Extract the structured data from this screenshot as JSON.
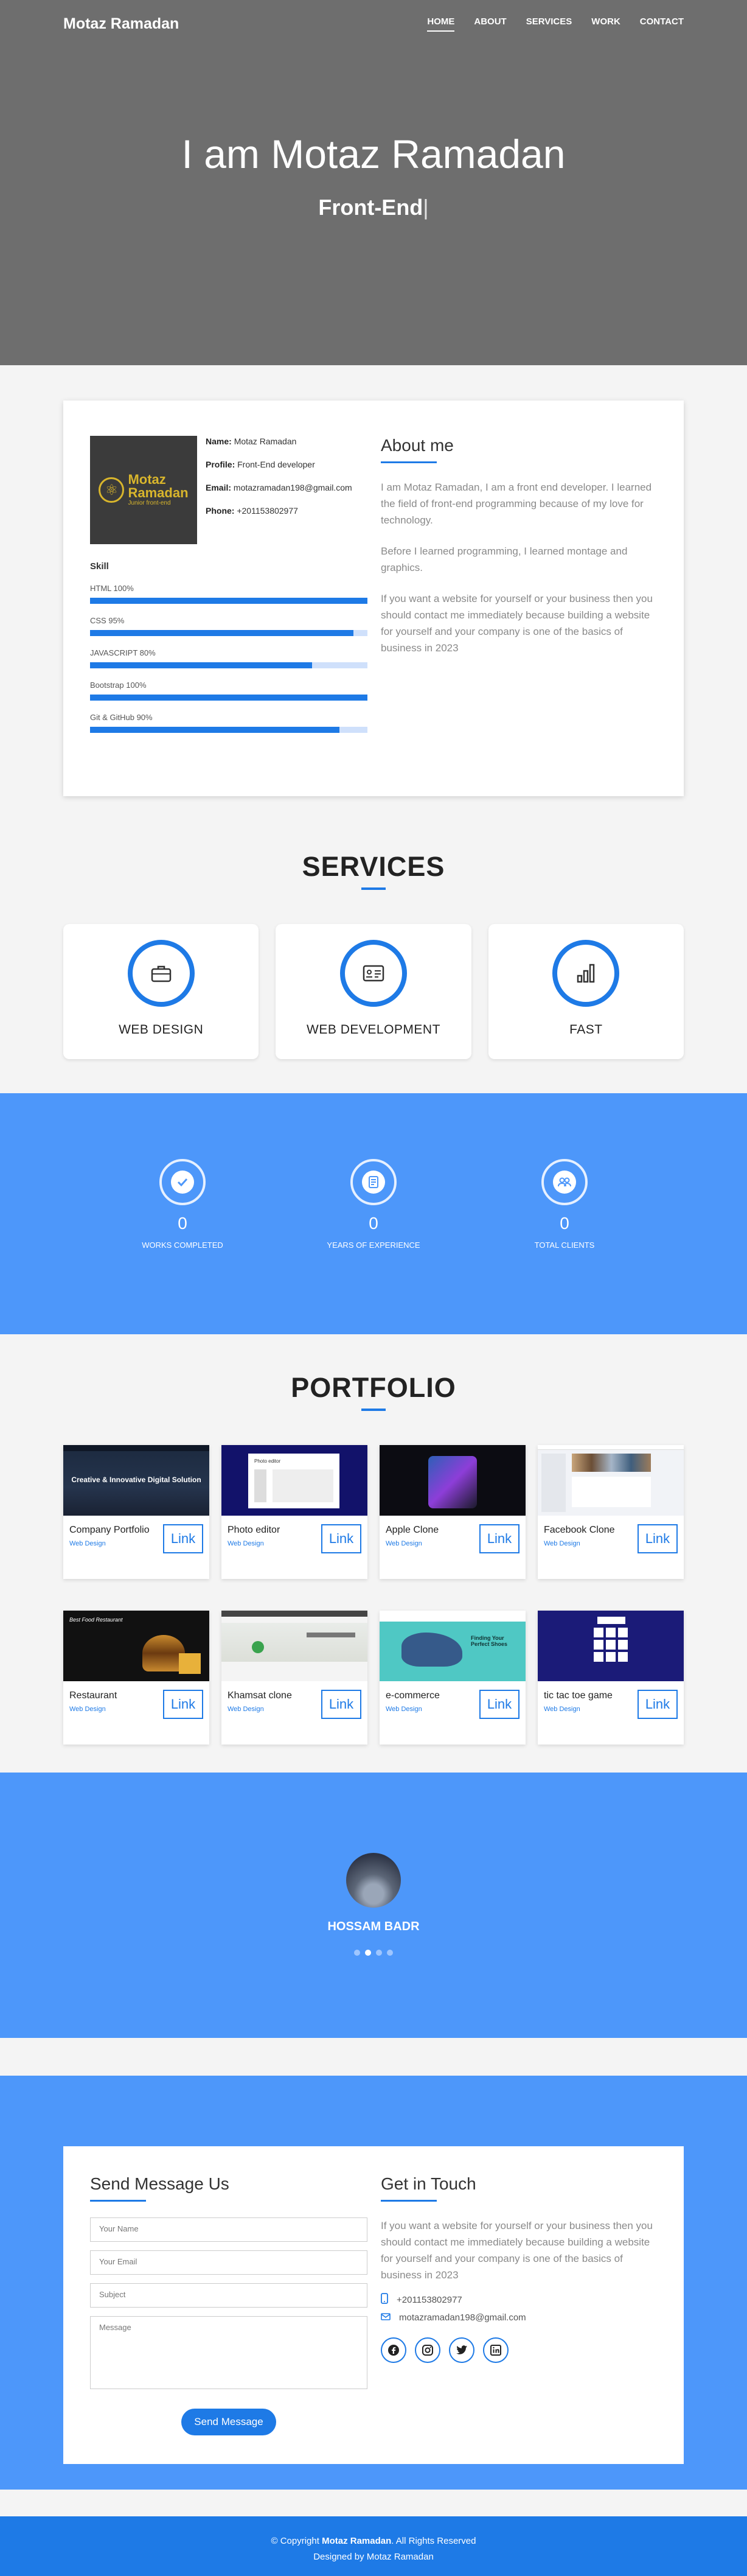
{
  "nav": {
    "brand": "Motaz Ramadan",
    "links": [
      "HOME",
      "ABOUT",
      "SERVICES",
      "WORK",
      "CONTACT"
    ]
  },
  "hero": {
    "title": "I am Motaz Ramadan",
    "subtitle": "Front-End",
    "cursor": "|"
  },
  "about": {
    "logo": {
      "line1": "Motaz",
      "line2": "Ramadan",
      "line3": "Junior front-end"
    },
    "info": [
      {
        "label": "Name:",
        "value": "Motaz Ramadan"
      },
      {
        "label": "Profile:",
        "value": "Front-End developer"
      },
      {
        "label": "Email:",
        "value": "motazramadan198@gmail.com"
      },
      {
        "label": "Phone:",
        "value": "+201153802977"
      }
    ],
    "skill_title": "Skill",
    "skills": [
      {
        "label": "HTML 100%",
        "percent": 100
      },
      {
        "label": "CSS 95%",
        "percent": 95
      },
      {
        "label": "JAVASCRIPT 80%",
        "percent": 80
      },
      {
        "label": "Bootstrap 100%",
        "percent": 100
      },
      {
        "label": "Git & GitHub 90%",
        "percent": 90
      }
    ],
    "heading": "About me",
    "paragraphs": [
      "I am Motaz Ramadan, I am a front end developer. I learned the field of front-end programming because of my love for technology.",
      "Before I learned programming, I learned montage and graphics.",
      "If you want a website for yourself or your business then you should contact me immediately because building a website for yourself and your company is one of the basics of business in 2023"
    ]
  },
  "services": {
    "title": "SERVICES",
    "items": [
      {
        "name": "WEB DESIGN",
        "icon": "briefcase-icon"
      },
      {
        "name": "WEB DEVELOPMENT",
        "icon": "id-card-icon"
      },
      {
        "name": "FAST",
        "icon": "bar-chart-icon"
      }
    ]
  },
  "stats": [
    {
      "number": "0",
      "label": "WORKS COMPLETED",
      "icon": "check-icon"
    },
    {
      "number": "0",
      "label": "YEARS OF EXPERIENCE",
      "icon": "document-icon"
    },
    {
      "number": "0",
      "label": "TOTAL CLIENTS",
      "icon": "people-icon"
    }
  ],
  "portfolio": {
    "title": "PORTFOLIO",
    "link_label": "Link",
    "items": [
      {
        "title": "Company Portfolio",
        "category": "Web Design",
        "thumb_title": "Creative & Innovative Digital Solution"
      },
      {
        "title": "Photo editor",
        "category": "Web Design",
        "thumb_title": "Photo editor"
      },
      {
        "title": "Apple Clone",
        "category": "Web Design",
        "thumb_title": ""
      },
      {
        "title": "Facebook Clone",
        "category": "Web Design",
        "thumb_title": ""
      },
      {
        "title": "Restaurant",
        "category": "Web Design",
        "thumb_title": "Best Food Restaurant"
      },
      {
        "title": "Khamsat clone",
        "category": "Web Design",
        "thumb_title": ""
      },
      {
        "title": "e-commerce",
        "category": "Web Design",
        "thumb_title": "Finding Your Perfect Shoes"
      },
      {
        "title": "tic tac toe game",
        "category": "Web Design",
        "thumb_title": ""
      }
    ]
  },
  "testimonial": {
    "name": "HOSSAM BADR",
    "dots": 4,
    "active_dot": 1
  },
  "contact": {
    "form_heading": "Send Message Us",
    "placeholders": {
      "name": "Your Name",
      "email": "Your Email",
      "subject": "Subject",
      "message": "Message"
    },
    "send_label": "Send Message",
    "touch_heading": "Get in Touch",
    "touch_text": "If you want a website for yourself or your business then you should contact me immediately because building a website for yourself and your company is one of the basics of business in 2023",
    "phone": "+201153802977",
    "email": "motazramadan198@gmail.com",
    "socials": [
      "facebook-icon",
      "instagram-icon",
      "twitter-icon",
      "linkedin-icon"
    ]
  },
  "footer": {
    "copyright_prefix": "© Copyright",
    "copyright_name": "Motaz Ramadan",
    "copyright_suffix": ". All Rights Reserved",
    "designed_by": "Designed by Motaz Ramadan"
  },
  "colors": {
    "accent": "#1e7ae6",
    "section_blue": "#4d97fa",
    "hero_gray": "#6e6e6e"
  }
}
